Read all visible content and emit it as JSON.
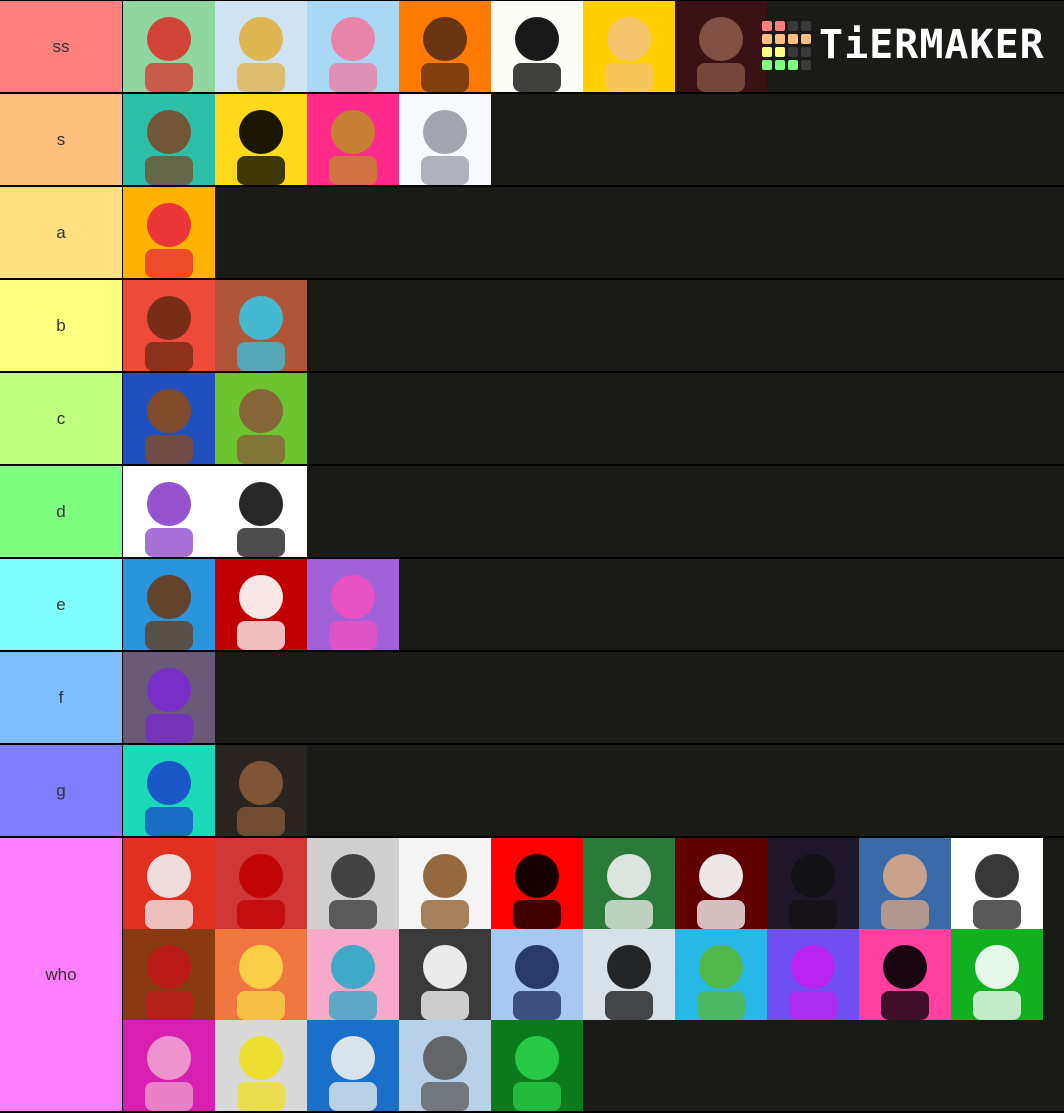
{
  "app": {
    "logo_text": "TiERMAKER",
    "logo_grid": [
      [
        "#ff7f7f",
        "#ff7f7f",
        "#3a3a3a",
        "#3a3a3a"
      ],
      [
        "#ffbf7f",
        "#ffbf7f",
        "#ffbf7f",
        "#ffbf7f"
      ],
      [
        "#ffff7f",
        "#ffff7f",
        "#3a3a3a",
        "#3a3a3a"
      ],
      [
        "#7fff7f",
        "#7fff7f",
        "#7fff7f",
        "#3a3a3a"
      ]
    ]
  },
  "tiers": [
    {
      "label": "ss",
      "color": "#ff7f7f",
      "items": [
        {
          "name": "cartoon-boy-red-shirt",
          "bg": "#8fd6a0",
          "fg": "#d9342b"
        },
        {
          "name": "roblox-santa-hat-yellow-suit",
          "bg": "#cfe3f2",
          "fg": "#e0b040"
        },
        {
          "name": "flamingo-bird-cartoon",
          "bg": "#a8d8f4",
          "fg": "#f07aa0"
        },
        {
          "name": "angry-boy-orange-stars",
          "bg": "#ff7a00",
          "fg": "#5a2e14"
        },
        {
          "name": "roblox-logo",
          "bg": "#fdfdf8",
          "fg": "#000000"
        },
        {
          "name": "blonde-boy-yellow",
          "bg": "#ffd000",
          "fg": "#f5c27a"
        },
        {
          "name": "demon-girl-dark-red",
          "bg": "#3a1216",
          "fg": "#8a5a48"
        }
      ]
    },
    {
      "label": "s",
      "color": "#ffbf7f",
      "items": [
        {
          "name": "smiling-boy-teal",
          "bg": "#2ebfa8",
          "fg": "#7a4a2a"
        },
        {
          "name": "inoobe-yellow-face",
          "bg": "#ffd91a",
          "fg": "#000000"
        },
        {
          "name": "tiger-hat-sunglasses",
          "bg": "#ff2a8a",
          "fg": "#c08a2a"
        },
        {
          "name": "cat-girl-top-hat",
          "bg": "#f8f8ff",
          "fg": "#9a9aa8"
        }
      ]
    },
    {
      "label": "a",
      "color": "#ffdf7f",
      "items": [
        {
          "name": "the-pals-logo",
          "bg": "#ffb300",
          "fg": "#e8283c"
        }
      ]
    },
    {
      "label": "b",
      "color": "#ffff7f",
      "items": [
        {
          "name": "masked-brown-hair-red",
          "bg": "#ee4a3a",
          "fg": "#6a2a14"
        },
        {
          "name": "roblox-blue-hat-desert",
          "bg": "#b0543a",
          "fg": "#3ac4e0"
        }
      ]
    },
    {
      "label": "c",
      "color": "#bfff7f",
      "items": [
        {
          "name": "headphones-antlers-blue",
          "bg": "#2050c0",
          "fg": "#8a4a1a"
        },
        {
          "name": "boy-green-robot",
          "bg": "#6cc530",
          "fg": "#8a5a3a"
        }
      ]
    },
    {
      "label": "d",
      "color": "#7fff7f",
      "items": [
        {
          "name": "mathorix-purple-badge",
          "bg": "#ffffff",
          "fg": "#8a40c8"
        },
        {
          "name": "roblox-black-outfit-white",
          "bg": "#ffffff",
          "fg": "#111111"
        }
      ]
    },
    {
      "label": "e",
      "color": "#7fffff",
      "items": [
        {
          "name": "boy-pointing-blue",
          "bg": "#2a94dc",
          "fg": "#6a3a1a"
        },
        {
          "name": "white-head-sunglasses-red",
          "bg": "#c00000",
          "fg": "#ffffff"
        },
        {
          "name": "pink-hair-husky-purple",
          "bg": "#a060d8",
          "fg": "#f050c0"
        }
      ]
    },
    {
      "label": "f",
      "color": "#7fbfff",
      "items": [
        {
          "name": "purple-striped-roblox",
          "bg": "#6a5a78",
          "fg": "#7a2ad0"
        }
      ]
    },
    {
      "label": "g",
      "color": "#7f7fff",
      "items": [
        {
          "name": "blue-hair-girl-teal",
          "bg": "#1ad8b8",
          "fg": "#1a4ac8"
        },
        {
          "name": "cap-boy-gold-chain",
          "bg": "#2a2420",
          "fg": "#8a5a3a"
        }
      ]
    },
    {
      "label": "who",
      "color": "#ff7fff",
      "items": [
        {
          "name": "top-hat-sunglasses-angel",
          "bg": "#e03020",
          "fg": "#f0f0f0"
        },
        {
          "name": "red-devil-block",
          "bg": "#d03838",
          "fg": "#c00000"
        },
        {
          "name": "grey-bandana-goggles",
          "bg": "#cfcfcf",
          "fg": "#333333"
        },
        {
          "name": "dog-ears-white",
          "bg": "#f4f4f4",
          "fg": "#8a5a2a"
        },
        {
          "name": "checkered-hat-red",
          "bg": "#ff0000",
          "fg": "#000000"
        },
        {
          "name": "toxic-green-text",
          "bg": "#2a7a3a",
          "fg": "#f0f0f0"
        },
        {
          "name": "e-logo-red-black",
          "bg": "#600000",
          "fg": "#ffffff"
        },
        {
          "name": "bowler-hat-mask-purple",
          "bg": "#20182a",
          "fg": "#111111"
        },
        {
          "name": "glasses-man-photo",
          "bg": "#3a6aa8",
          "fg": "#d8a888"
        },
        {
          "name": "hooded-roblox-white",
          "bg": "#ffffff",
          "fg": "#222222"
        },
        {
          "name": "orange-hair-axe",
          "bg": "#8a3a10",
          "fg": "#c01818"
        },
        {
          "name": "blonde-cat-ears-sunglasses",
          "bg": "#f07840",
          "fg": "#f8d848"
        },
        {
          "name": "shark-hoodie-girl-pink",
          "bg": "#f8a8c8",
          "fg": "#2aa8c8"
        },
        {
          "name": "monochrome-roblox-goggles",
          "bg": "#3a3a3a",
          "fg": "#ffffff"
        },
        {
          "name": "blue-scarf-runner",
          "bg": "#a8c8f0",
          "fg": "#1a2a5a"
        },
        {
          "name": "penguin-glowing",
          "bg": "#d8e0e8",
          "fg": "#111111"
        },
        {
          "name": "dino-hat-crocodile",
          "bg": "#28b8e8",
          "fg": "#58b838"
        },
        {
          "name": "r-logo-gradient",
          "bg": "#7050f0",
          "fg": "#c020f0"
        },
        {
          "name": "pink-pixel-face",
          "bg": "#ff40a0",
          "fg": "#000000"
        },
        {
          "name": "chef-hat-gasmask-green",
          "bg": "#10b020",
          "fg": "#ffffff"
        },
        {
          "name": "pink-hair-thumbs-up",
          "bg": "#d820b0",
          "fg": "#f0a0d0"
        },
        {
          "name": "yellow-head-green-body",
          "bg": "#d8d8d8",
          "fg": "#f0e020"
        },
        {
          "name": "spiked-crown-roblox",
          "bg": "#1a70c8",
          "fg": "#f0f0f0"
        },
        {
          "name": "pirate-parrot",
          "bg": "#b8d0e8",
          "fg": "#5a5a5a"
        },
        {
          "name": "green-n-top-hat",
          "bg": "#0a7a1a",
          "fg": "#2ad04a"
        }
      ]
    }
  ]
}
